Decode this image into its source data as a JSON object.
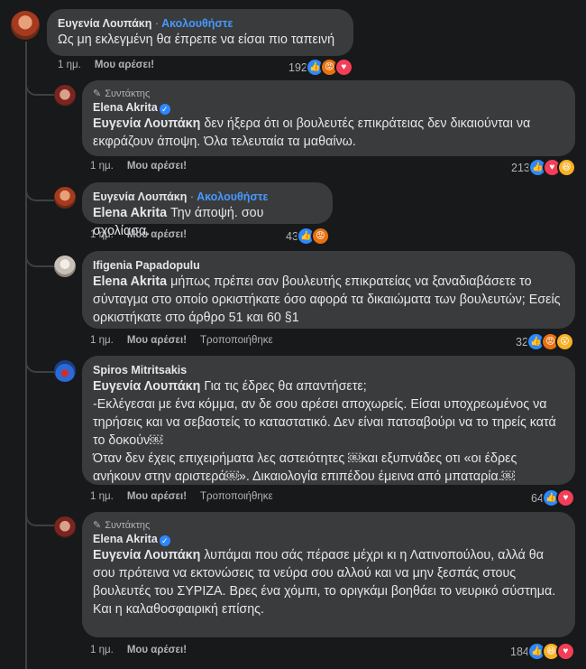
{
  "meta": {
    "role_label": "Συντάκτης",
    "follow_label": "Ακολουθήστε",
    "like_label": "Μου αρέσει!",
    "edited_label": "Τροποποιήθηκε",
    "time_label": "1 ημ."
  },
  "comments": [
    {
      "author": "Ευγενία Λουπάκη",
      "text": "Ως μη εκλεγμένη θα έπρεπε να είσαι πιο ταπεινή",
      "count": "192"
    },
    {
      "author": "Elena Akrita",
      "mention": "Ευγενία Λουπάκη",
      "text": "δεν ήξερα ότι οι βουλευτές επικράτειας δεν δικαιούνται να εκφράζουν άποψη. Όλα τελευταία τα μαθαίνω.",
      "count": "213"
    },
    {
      "author": "Ευγενία Λουπάκη",
      "mention": "Elena Akrita",
      "text": "Την άποψή. σου σχολίασα.",
      "count": "43"
    },
    {
      "author": "Ifigenia Papadopulu",
      "mention": "Elena Akrita",
      "text": "μήπως πρέπει σαν βουλευτής επικρατείας να ξαναδιαβάσετε το σύνταγμα στο οποίο ορκιστήκατε όσο αφορά τα δικαιώματα των βουλευτών; Εσείς ορκιστήκατε στο άρθρο 51 και 60 §1",
      "count": "32"
    },
    {
      "author": "Spiros Mitritsakis",
      "mention": "Ευγενία Λουπάκη",
      "text": "Για τις έδρες θα απαντήσετε;\n-Εκλέγεσαι με ένα κόμμα, αν δε σου αρέσει αποχωρείς. Είσαι υποχρεωμένος να τηρήσεις και να σεβαστείς το καταστατικό. Δεν είναι πατσαβούρι να το τηρείς κατά το δοκούν￼\nΌταν δεν έχεις επιχειρήματα λες αστειότητες ￼και εξυπνάδες οτι «οι έδρες ανήκουν στην αριστερά￼». Δικαιολογία επιπέδου έμεινα από μπαταρία.￼",
      "count": "64"
    },
    {
      "author": "Elena Akrita",
      "mention": "Ευγενία Λουπάκη",
      "text": "λυπάμαι που σάς πέρασε μέχρι κι η Λατινοπούλου, αλλά θα σου πρότεινα να εκτονώσεις τα νεύρα σου αλλού και να μην ξεσπάς στους βουλευτές του ΣΥΡΙΖΑ. Βρες ένα χόμπι, το οριγκάμι βοηθάει το νευρικό σύστημα.\nΚαι η καλαθοσφαιρική επίσης.",
      "count": "184"
    }
  ]
}
